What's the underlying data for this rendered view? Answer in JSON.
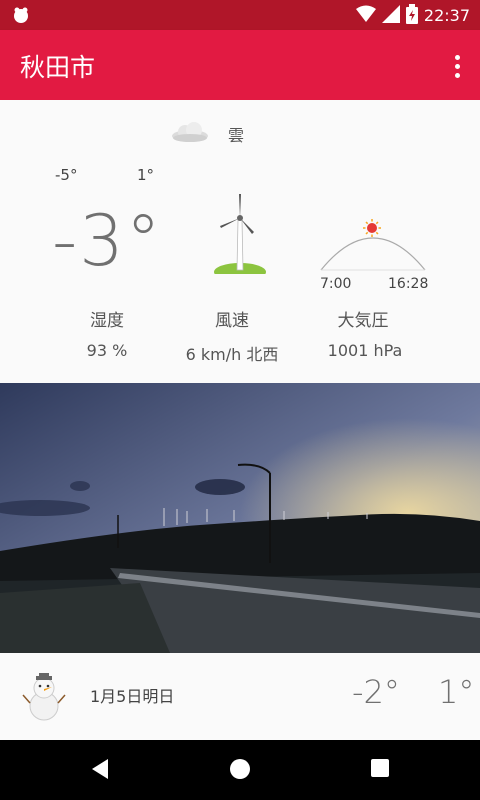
{
  "status_bar": {
    "time": "22:37",
    "icons": [
      "notification-icon",
      "wifi-icon",
      "signal-icon",
      "battery-charging-icon"
    ]
  },
  "app_bar": {
    "title": "秋田市",
    "menu_icon": "overflow-menu-icon"
  },
  "current": {
    "condition_icon": "cloud-icon",
    "condition": "雲",
    "low": "-5°",
    "high": "1°",
    "temperature": "-3°",
    "sunrise": "7:00",
    "sunset": "16:28",
    "stats": [
      {
        "label": "湿度",
        "value": "93 %"
      },
      {
        "label": "風速",
        "value": "6 km/h 北西"
      },
      {
        "label": "大気圧",
        "value": "1001 hPa"
      }
    ]
  },
  "forecast": [
    {
      "icon": "snowman-icon",
      "date": "1月5日明日",
      "low": "-2°",
      "high": "1°"
    }
  ],
  "nav": [
    "back-icon",
    "home-icon",
    "recents-icon"
  ],
  "colors": {
    "status_bar": "#b01629",
    "app_bar": "#e21a42",
    "background": "#fafafa",
    "nav_bar": "#000000"
  }
}
